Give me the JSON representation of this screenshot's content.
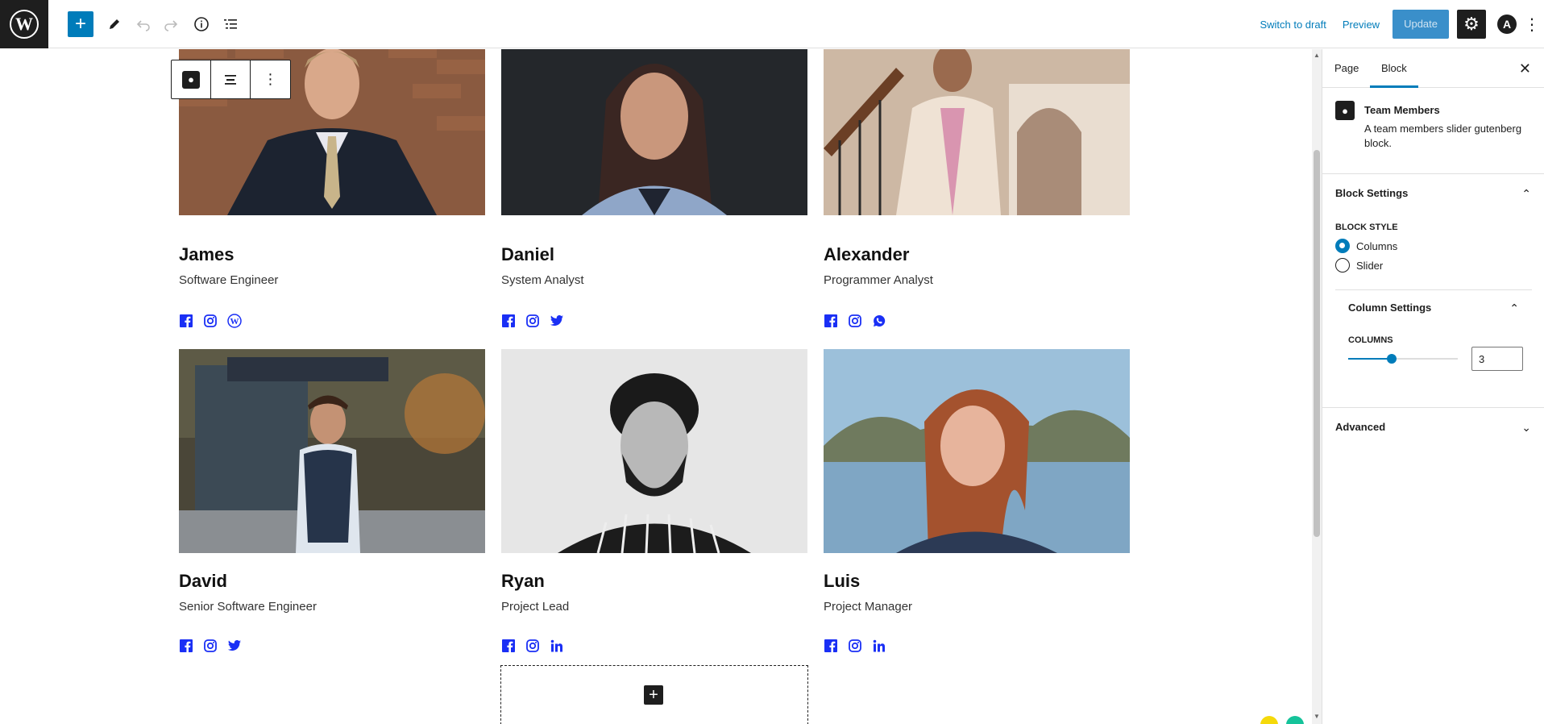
{
  "toolbar": {
    "switch_to_draft": "Switch to draft",
    "preview": "Preview",
    "update": "Update"
  },
  "team": [
    {
      "name": "James",
      "role": "Software Engineer",
      "socials": [
        "facebook-icon",
        "instagram-icon",
        "wordpress-icon"
      ]
    },
    {
      "name": "Daniel",
      "role": "System Analyst",
      "socials": [
        "facebook-icon",
        "instagram-icon",
        "twitter-icon"
      ]
    },
    {
      "name": "Alexander",
      "role": "Programmer Analyst",
      "socials": [
        "facebook-icon",
        "instagram-icon",
        "whatsapp-icon"
      ]
    },
    {
      "name": "David",
      "role": "Senior Software Engineer",
      "socials": [
        "facebook-icon",
        "instagram-icon",
        "twitter-icon"
      ]
    },
    {
      "name": "Ryan",
      "role": "Project Lead",
      "socials": [
        "facebook-icon",
        "instagram-icon",
        "linkedin-icon"
      ]
    },
    {
      "name": "Luis",
      "role": "Project Manager",
      "socials": [
        "facebook-icon",
        "instagram-icon",
        "linkedin-icon"
      ]
    }
  ],
  "sidebar": {
    "tabs": [
      "Page",
      "Block"
    ],
    "active_tab": "Block",
    "block_title": "Team Members",
    "block_description": "A team members slider gutenberg block.",
    "block_settings_label": "Block Settings",
    "block_style_label": "BLOCK STYLE",
    "style_options": [
      "Columns",
      "Slider"
    ],
    "selected_style": "Columns",
    "column_settings_label": "Column Settings",
    "columns_label": "COLUMNS",
    "columns_value": "3",
    "columns_slider_fraction": 0.4,
    "advanced_label": "Advanced"
  },
  "colors": {
    "accent": "#007cba",
    "social_icon": "#1a2ff5",
    "dark": "#1e1e1e"
  }
}
